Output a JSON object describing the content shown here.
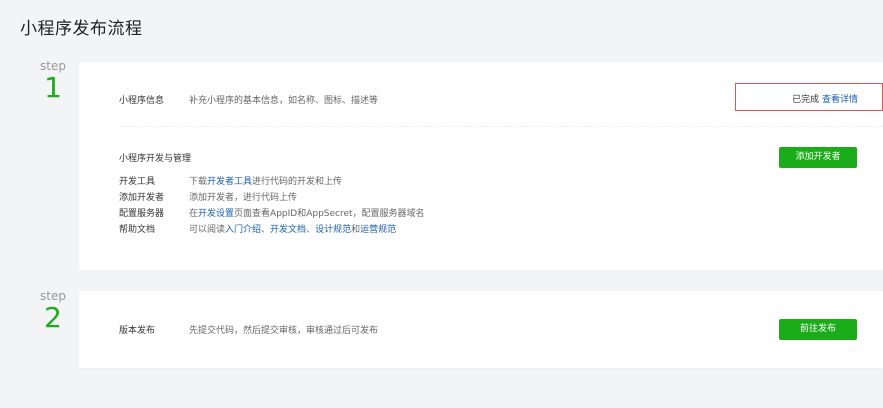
{
  "page_title": "小程序发布流程",
  "colors": {
    "accent": "#1aad19",
    "link": "#1a5fb4",
    "highlight_border": "#e15656"
  },
  "step1": {
    "step_label": "step",
    "number": "1",
    "info": {
      "label": "小程序信息",
      "desc": "补充小程序的基本信息，如名称、图标、描述等",
      "status": "已完成",
      "detail_link": "查看详情"
    },
    "dev": {
      "title": "小程序开发与管理",
      "button": "添加开发者",
      "rows": [
        {
          "label": "开发工具",
          "parts": [
            {
              "t": "下载",
              "link": false
            },
            {
              "t": "开发者工具",
              "link": true
            },
            {
              "t": "进行代码的开发和上传",
              "link": false
            }
          ]
        },
        {
          "label": "添加开发者",
          "parts": [
            {
              "t": "添加开发者，进行代码上传",
              "link": false
            }
          ]
        },
        {
          "label": "配置服务器",
          "parts": [
            {
              "t": "在",
              "link": false
            },
            {
              "t": "开发设置",
              "link": true
            },
            {
              "t": "页面查看AppID和AppSecret，配置服务器域名",
              "link": false
            }
          ]
        },
        {
          "label": "帮助文档",
          "parts": [
            {
              "t": "可以阅读",
              "link": false
            },
            {
              "t": "入门介绍",
              "link": true
            },
            {
              "t": "、",
              "link": false
            },
            {
              "t": "开发文档",
              "link": true
            },
            {
              "t": "、",
              "link": false
            },
            {
              "t": "设计规范",
              "link": true
            },
            {
              "t": "和",
              "link": false
            },
            {
              "t": "运营规范",
              "link": true
            }
          ]
        }
      ]
    }
  },
  "step2": {
    "step_label": "step",
    "number": "2",
    "label": "版本发布",
    "desc": "先提交代码，然后提交审核，审核通过后可发布",
    "button": "前往发布"
  }
}
